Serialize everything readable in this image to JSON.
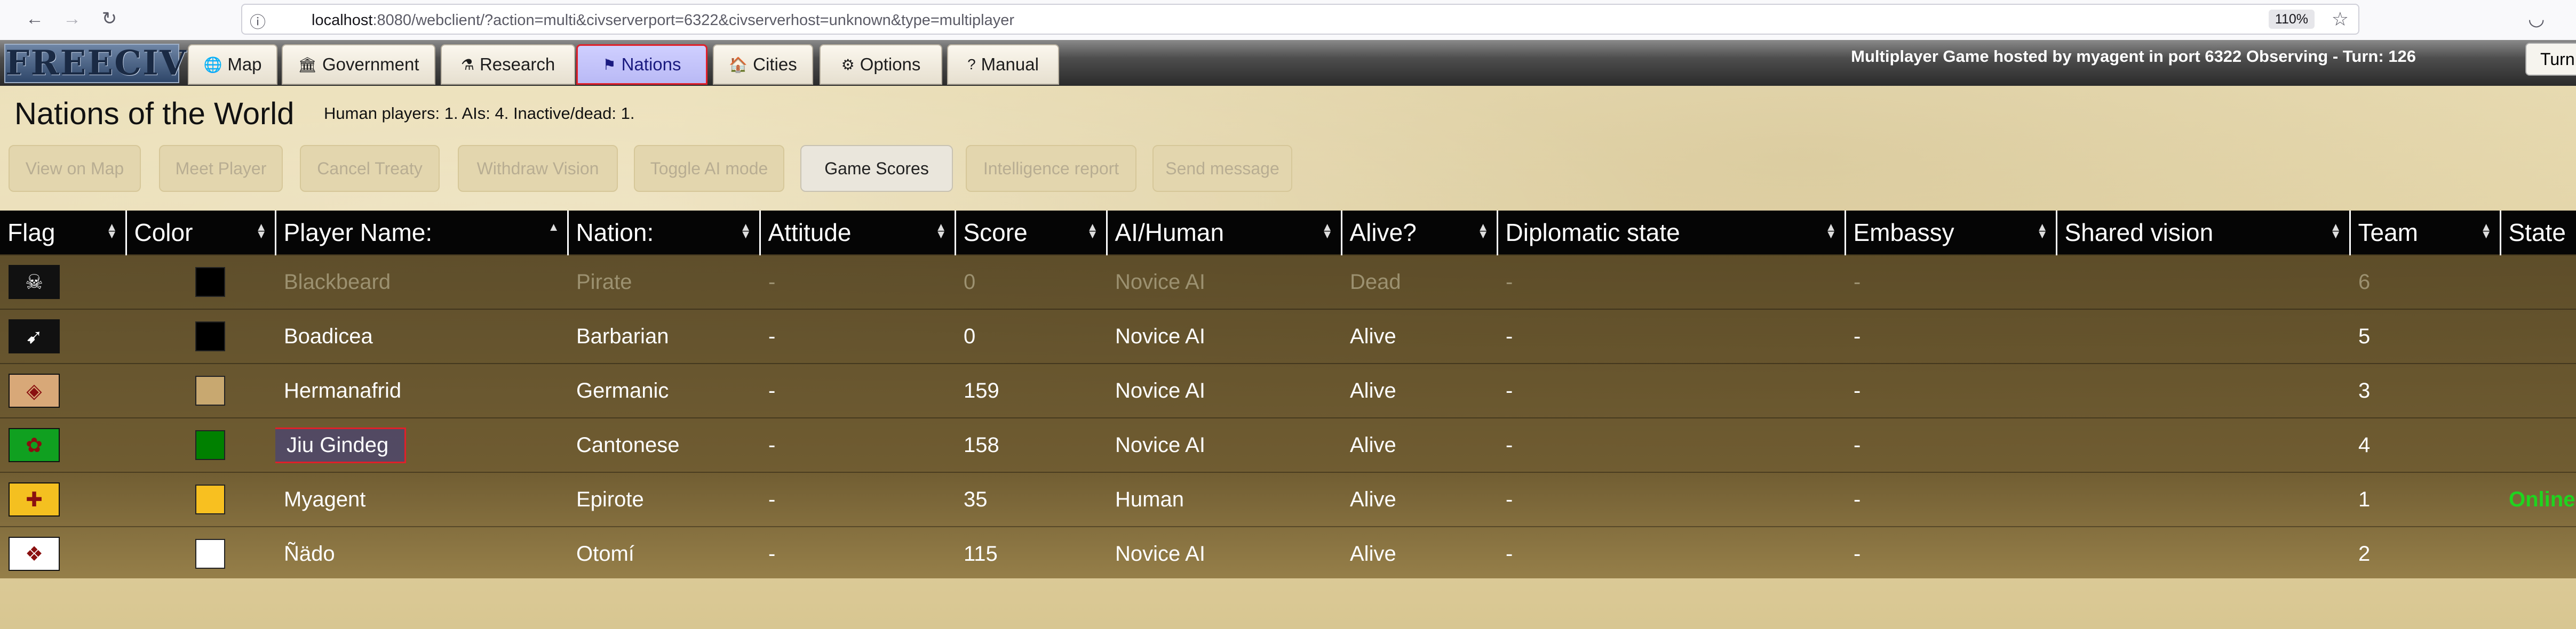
{
  "browser": {
    "url_host": "localhost",
    "url_rest": ":8080/webclient/?action=multi&civserverport=6322&civserverhost=unknown&type=multiplayer",
    "zoom": "110%"
  },
  "menu": {
    "logo": "FREECIV",
    "tabs": [
      {
        "label": "Map",
        "icon": "globe-icon",
        "glyph": "🌐"
      },
      {
        "label": "Government",
        "icon": "government-icon",
        "glyph": "🏛"
      },
      {
        "label": "Research",
        "icon": "flask-icon",
        "glyph": "⚗"
      },
      {
        "label": "Nations",
        "icon": "flag-icon",
        "glyph": "⚑"
      },
      {
        "label": "Cities",
        "icon": "city-icon",
        "glyph": "🏠"
      },
      {
        "label": "Options",
        "icon": "gears-icon",
        "glyph": "⚙"
      },
      {
        "label": "Manual",
        "icon": "help-icon",
        "glyph": "?"
      }
    ],
    "active_tab": "Nations",
    "hosted_text": "Multiplayer Game hosted by myagent in port 6322 Observing - Turn: 126",
    "turn_button": "Turn"
  },
  "page": {
    "title": "Nations of the World",
    "summary": "Human players: 1. AIs: 4. Inactive/dead: 1."
  },
  "actions": [
    {
      "label": "View on Map",
      "enabled": false
    },
    {
      "label": "Meet Player",
      "enabled": false
    },
    {
      "label": "Cancel Treaty",
      "enabled": false
    },
    {
      "label": "Withdraw Vision",
      "enabled": false
    },
    {
      "label": "Toggle AI mode",
      "enabled": false
    },
    {
      "label": "Game Scores",
      "enabled": true
    },
    {
      "label": "Intelligence report",
      "enabled": false
    },
    {
      "label": "Send message",
      "enabled": false
    }
  ],
  "table": {
    "headers": [
      "Flag",
      "Color",
      "Player Name:",
      "Nation:",
      "Attitude",
      "Score",
      "AI/Human",
      "Alive?",
      "Diplomatic state",
      "Embassy",
      "Shared vision",
      "Team",
      "State"
    ],
    "rows": [
      {
        "flag": "pirate-flag-icon",
        "flag_glyph": "☠",
        "flag_bg": "#111111",
        "color": "#000000",
        "name": "Blackbeard",
        "nation": "Pirate",
        "attitude": "-",
        "score": "0",
        "ai": "Novice AI",
        "alive": "Dead",
        "diplomatic": "-",
        "embassy": "-",
        "vision": "",
        "team": "6",
        "state": "",
        "dead": true
      },
      {
        "flag": "barbarian-flag-icon",
        "flag_glyph": "➹",
        "flag_bg": "#111111",
        "color": "#000000",
        "name": "Boadicea",
        "nation": "Barbarian",
        "attitude": "-",
        "score": "0",
        "ai": "Novice AI",
        "alive": "Alive",
        "diplomatic": "-",
        "embassy": "-",
        "vision": "",
        "team": "5",
        "state": "",
        "dead": false
      },
      {
        "flag": "germanic-flag-icon",
        "flag_glyph": "◈",
        "flag_bg": "#d8a878",
        "color": "#c8a870",
        "name": "Hermanafrid",
        "nation": "Germanic",
        "attitude": "-",
        "score": "159",
        "ai": "Novice AI",
        "alive": "Alive",
        "diplomatic": "-",
        "embassy": "-",
        "vision": "",
        "team": "3",
        "state": "",
        "dead": false
      },
      {
        "flag": "cantonese-flag-icon",
        "flag_glyph": "✿",
        "flag_bg": "#10a020",
        "color": "#008000",
        "name": "Jiu Gindeg",
        "nation": "Cantonese",
        "attitude": "-",
        "score": "158",
        "ai": "Novice AI",
        "alive": "Alive",
        "diplomatic": "-",
        "embassy": "-",
        "vision": "",
        "team": "4",
        "state": "",
        "dead": false,
        "selected": true
      },
      {
        "flag": "epirote-flag-icon",
        "flag_glyph": "✚",
        "flag_bg": "#f4c020",
        "color": "#f8c020",
        "name": "Myagent",
        "nation": "Epirote",
        "attitude": "-",
        "score": "35",
        "ai": "Human",
        "alive": "Alive",
        "diplomatic": "-",
        "embassy": "-",
        "vision": "",
        "team": "1",
        "state": "Online",
        "dead": false
      },
      {
        "flag": "otomi-flag-icon",
        "flag_glyph": "❖",
        "flag_bg": "#ffffff",
        "color": "#ffffff",
        "name": "Ñädo",
        "nation": "Otomí",
        "attitude": "-",
        "score": "115",
        "ai": "Novice AI",
        "alive": "Alive",
        "diplomatic": "-",
        "embassy": "-",
        "vision": "",
        "team": "2",
        "state": "",
        "dead": false
      }
    ]
  }
}
